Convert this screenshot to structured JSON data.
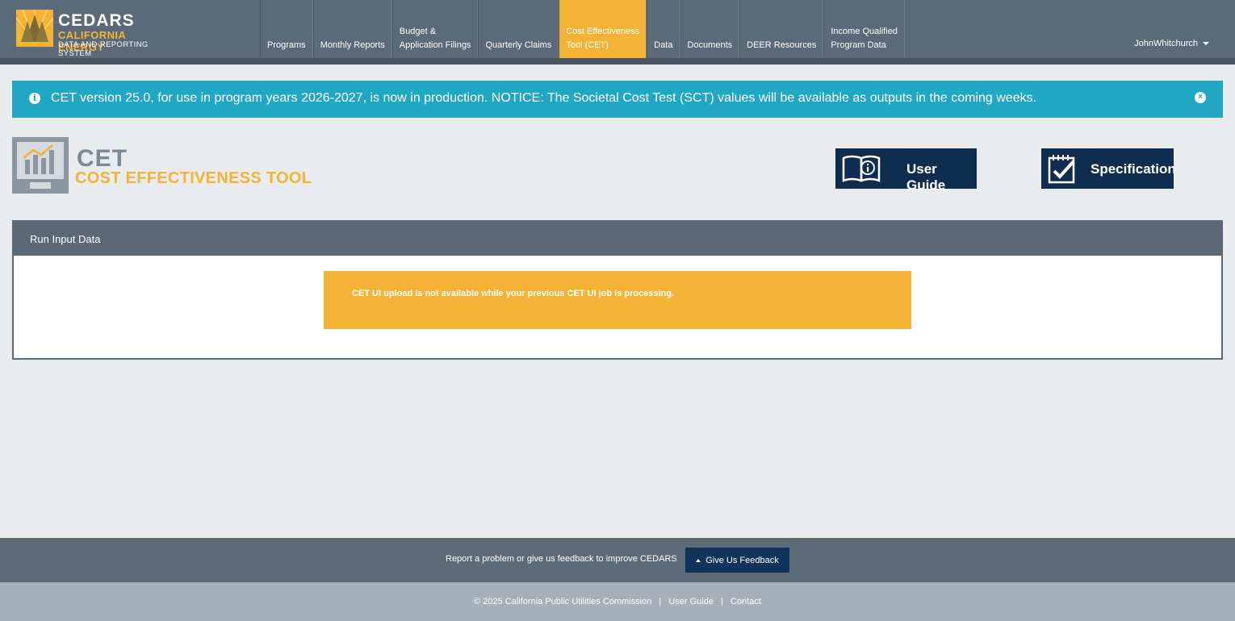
{
  "brand": {
    "title": "CEDARS",
    "subtitle": "CALIFORNIA ENERGY",
    "tagline": "DATA AND REPORTING SYSTEM"
  },
  "nav": {
    "items": [
      {
        "label": "Programs"
      },
      {
        "label": "Monthly Reports"
      },
      {
        "label": "Budget &\nApplication Filings"
      },
      {
        "label": "Quarterly Claims"
      },
      {
        "label": "Cost Effectiveness\nTool (CET)"
      },
      {
        "label": "Data"
      },
      {
        "label": "Documents"
      },
      {
        "label": "DEER Resources"
      },
      {
        "label": "Income Qualified\nProgram Data"
      }
    ],
    "active_index": 4
  },
  "user": {
    "name": "JohnWhitchurch"
  },
  "alert": {
    "message": "CET version 25.0, for use in program years 2026-2027, is now in production. NOTICE: The Societal Cost Test (SCT) values will be available as outputs in the coming weeks."
  },
  "cet_logo": {
    "title": "CET",
    "subtitle": "COST EFFECTIVENESS TOOL"
  },
  "buttons": {
    "user_guide": "User Guide",
    "specification": "Specification"
  },
  "panel": {
    "title": "Run Input Data",
    "warning": "CET UI upload is not available while your previous CET UI job is processing."
  },
  "footer": {
    "report_text": "Report a problem or give us feedback to improve CEDARS",
    "feedback_button": "Give Us Feedback",
    "copyright": "© 2025 California Public Utilities Commission",
    "links": {
      "user_guide": "User Guide",
      "contact": "Contact"
    },
    "separator": "|"
  },
  "colors": {
    "header": "#5a6a78",
    "accent": "#f5b335",
    "info": "#20a7c4",
    "navy": "#0f2e4f"
  }
}
